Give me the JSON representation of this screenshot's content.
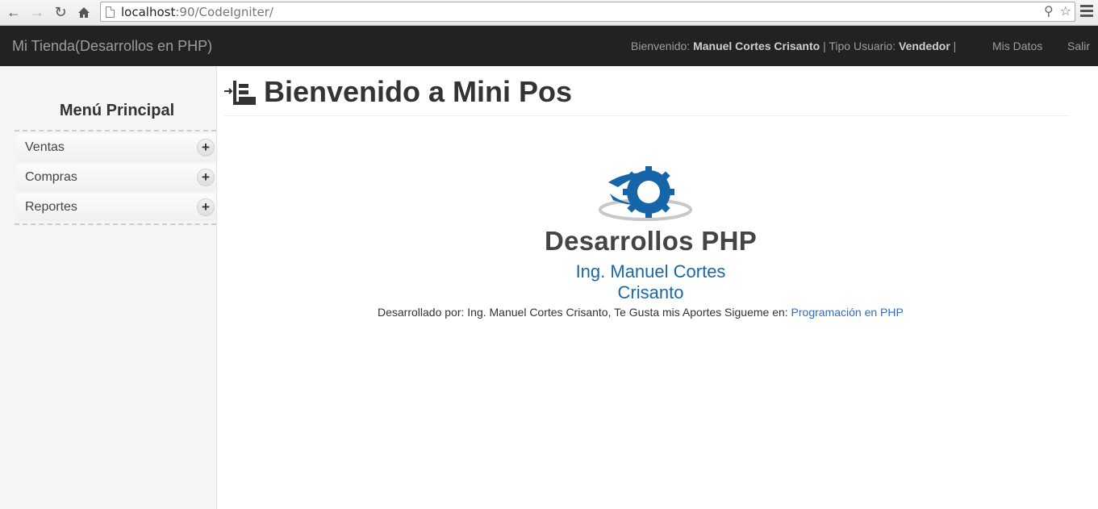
{
  "browser": {
    "url_host": "localhost",
    "url_rest": ":90/CodeIgniter/",
    "back_icon": "arrow-left-icon",
    "forward_icon": "arrow-right-icon",
    "reload_icon": "reload-icon",
    "home_icon": "home-icon"
  },
  "navbar": {
    "brand": "Mi Tienda(Desarrollos en PHP)",
    "welcome_prefix": "Bienvenido: ",
    "user_name": "Manuel Cortes Crisanto",
    "user_type_prefix": " | Tipo Usuario: ",
    "user_type": "Vendedor",
    "user_suffix": " |",
    "links": [
      "Mis Datos",
      "Salir"
    ]
  },
  "sidebar": {
    "title": "Menú Principal",
    "items": [
      {
        "label": "Ventas",
        "expand": "+"
      },
      {
        "label": "Compras",
        "expand": "+"
      },
      {
        "label": "Reportes",
        "expand": "+"
      }
    ]
  },
  "main": {
    "title": "Bienvenido a Mini Pos",
    "logo_title": "Desarrollos PHP",
    "logo_subtitle": "Ing. Manuel Cortes Crisanto",
    "footer_text": "Desarrollado por: Ing. Manuel Cortes Crisanto, Te Gusta mis Aportes Sigueme en: ",
    "footer_link": "Programación en PHP"
  },
  "colors": {
    "navbar_bg": "#222222",
    "link": "#2f6cc4",
    "logo_blue": "#1868a8"
  }
}
